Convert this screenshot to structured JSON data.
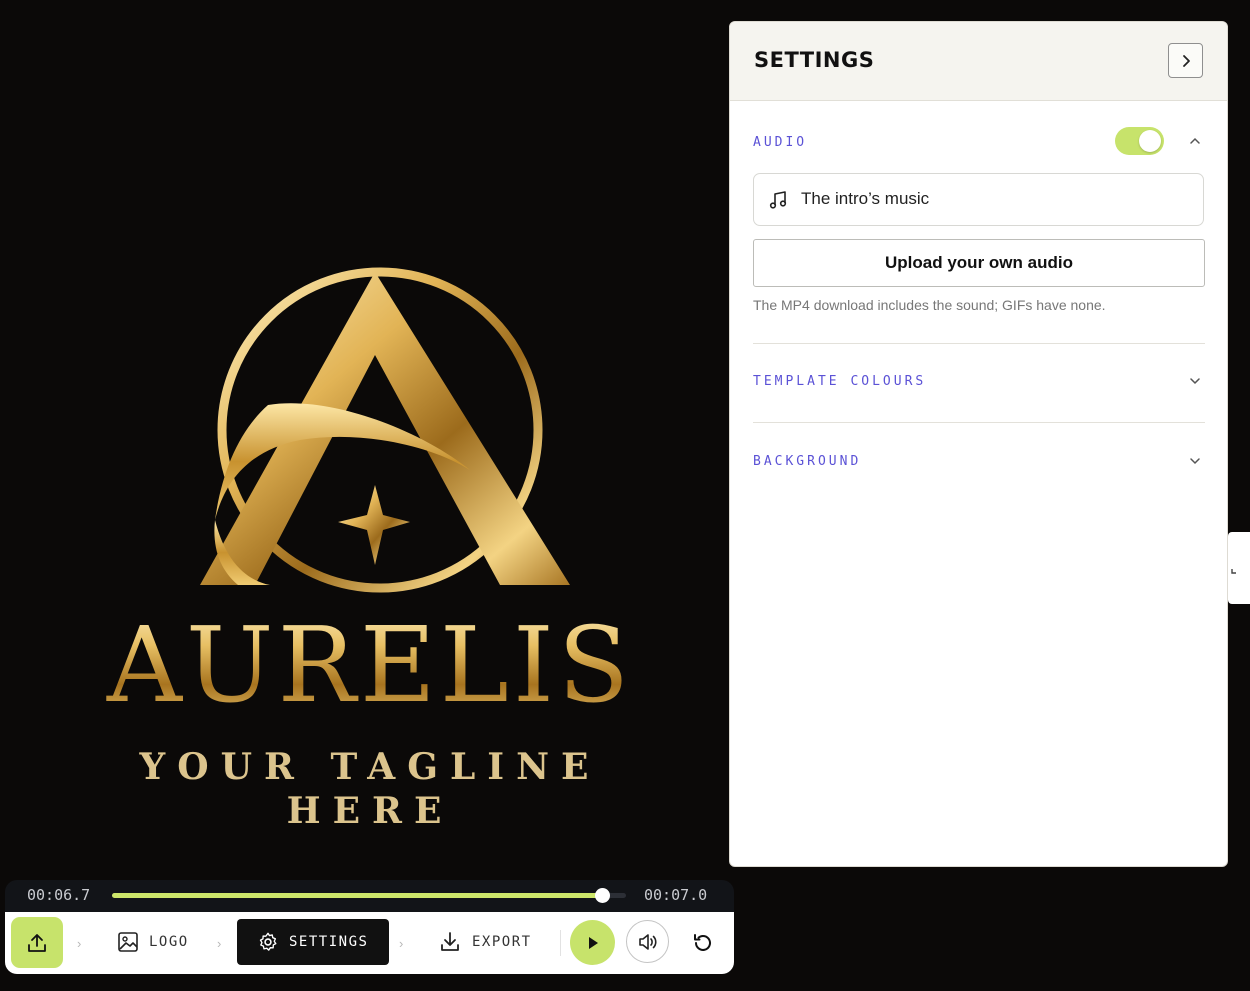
{
  "preview": {
    "brand_name": "AURELIS",
    "tagline": "YOUR TAGLINE HERE"
  },
  "settings": {
    "title": "SETTINGS",
    "collapse_icon": "chevron-right-icon",
    "audio": {
      "section_title": "AUDIO",
      "enabled": true,
      "track_name": "The intro’s music",
      "upload_label": "Upload your own audio",
      "hint": "The MP4 download includes the sound; GIFs have none."
    },
    "template_colours": {
      "section_title": "TEMPLATE COLOURS",
      "expanded": false
    },
    "background": {
      "section_title": "BACKGROUND",
      "expanded": false
    }
  },
  "timeline": {
    "current_time": "00:06.7",
    "total_time": "00:07.0",
    "progress": 0.953
  },
  "toolbar": {
    "steps": [
      {
        "label": "LOGO",
        "icon": "image-icon",
        "active": false
      },
      {
        "label": "SETTINGS",
        "icon": "gear-icon",
        "active": true
      },
      {
        "label": "EXPORT",
        "icon": "download-icon",
        "active": false
      }
    ]
  },
  "colors": {
    "accent": "#c7e36b",
    "section_title": "#5b52d6",
    "gold": "#d9b052"
  }
}
